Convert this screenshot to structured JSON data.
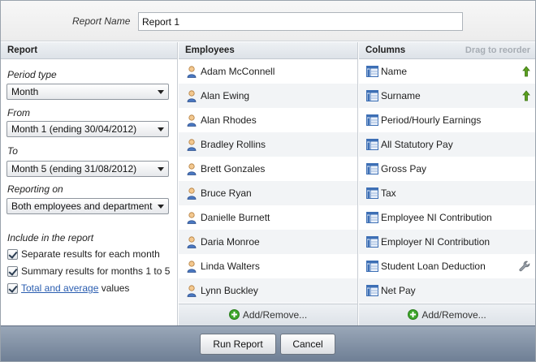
{
  "header": {
    "report_name_label": "Report Name",
    "report_name_value": "Report 1"
  },
  "report_panel": {
    "title": "Report",
    "period_type": {
      "label": "Period type",
      "value": "Month"
    },
    "from": {
      "label": "From",
      "value": "Month 1 (ending 30/04/2012)"
    },
    "to": {
      "label": "To",
      "value": "Month 5 (ending 31/08/2012)"
    },
    "reporting_on": {
      "label": "Reporting on",
      "value": "Both employees and department"
    },
    "include_label": "Include in the report",
    "options": [
      {
        "label": "Separate results for each month",
        "checked": true
      },
      {
        "label": "Summary results for months 1 to 5",
        "checked": true
      },
      {
        "link": "Total and average",
        "label": " values",
        "checked": true
      }
    ]
  },
  "employees_panel": {
    "title": "Employees",
    "items": [
      "Adam McConnell",
      "Alan Ewing",
      "Alan Rhodes",
      "Bradley Rollins",
      "Brett Gonzales",
      "Bruce Ryan",
      "Danielle Burnett",
      "Daria Monroe",
      "Linda Walters",
      "Lynn Buckley"
    ],
    "add_remove": "Add/Remove..."
  },
  "columns_panel": {
    "title": "Columns",
    "drag_hint": "Drag to reorder",
    "items": [
      "Name",
      "Surname",
      "Period/Hourly Earnings",
      "All Statutory Pay",
      "Gross Pay",
      "Tax",
      "Employee NI Contribution",
      "Employer NI Contribution",
      "Student Loan Deduction",
      "Net Pay"
    ],
    "sorted_indicator_icon": "green-up-arrow-icon",
    "settings_icon": "wrench-icon",
    "add_remove": "Add/Remove..."
  },
  "buttons": {
    "run": "Run Report",
    "cancel": "Cancel"
  },
  "colors": {
    "bottom_bar": "#7f8da1",
    "link": "#2a5db0",
    "add_green": "#3ea62b",
    "arrow_green": "#5aa01e"
  }
}
